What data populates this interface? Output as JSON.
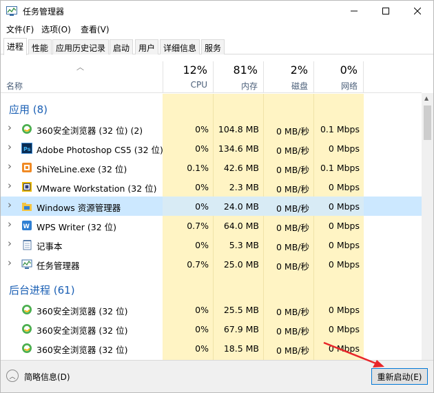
{
  "window": {
    "title": "任务管理器"
  },
  "menu": [
    "文件(F)",
    "选项(O)",
    "查看(V)"
  ],
  "tabs": [
    "进程",
    "性能",
    "应用历史记录",
    "启动",
    "用户",
    "详细信息",
    "服务"
  ],
  "columns": {
    "name": "名称",
    "cpu": {
      "pct": "12%",
      "label": "CPU"
    },
    "memory": {
      "pct": "81%",
      "label": "内存"
    },
    "disk": {
      "pct": "2%",
      "label": "磁盘"
    },
    "network": {
      "pct": "0%",
      "label": "网络"
    }
  },
  "groups": {
    "apps": "应用 (8)",
    "background": "后台进程 (61)"
  },
  "apps": [
    {
      "name": "360安全浏览器 (32 位) (2)",
      "cpu": "0%",
      "mem": "104.8 MB",
      "disk": "0 MB/秒",
      "net": "0.1 Mbps",
      "icon": "360-browser-icon"
    },
    {
      "name": "Adobe Photoshop CS5 (32 位)",
      "cpu": "0%",
      "mem": "134.6 MB",
      "disk": "0 MB/秒",
      "net": "0 Mbps",
      "icon": "photoshop-icon"
    },
    {
      "name": "ShiYeLine.exe (32 位)",
      "cpu": "0.1%",
      "mem": "42.6 MB",
      "disk": "0 MB/秒",
      "net": "0.1 Mbps",
      "icon": "shiyeline-icon"
    },
    {
      "name": "VMware Workstation (32 位)",
      "cpu": "0%",
      "mem": "2.3 MB",
      "disk": "0 MB/秒",
      "net": "0 Mbps",
      "icon": "vmware-icon"
    },
    {
      "name": "Windows 资源管理器",
      "cpu": "0%",
      "mem": "24.0 MB",
      "disk": "0 MB/秒",
      "net": "0 Mbps",
      "icon": "explorer-icon"
    },
    {
      "name": "WPS Writer (32 位)",
      "cpu": "0.7%",
      "mem": "64.0 MB",
      "disk": "0 MB/秒",
      "net": "0 Mbps",
      "icon": "wps-writer-icon"
    },
    {
      "name": "记事本",
      "cpu": "0%",
      "mem": "5.3 MB",
      "disk": "0 MB/秒",
      "net": "0 Mbps",
      "icon": "notepad-icon"
    },
    {
      "name": "任务管理器",
      "cpu": "0.7%",
      "mem": "25.0 MB",
      "disk": "0 MB/秒",
      "net": "0 Mbps",
      "icon": "task-manager-icon"
    }
  ],
  "background": [
    {
      "name": "360安全浏览器 (32 位)",
      "cpu": "0%",
      "mem": "25.5 MB",
      "disk": "0 MB/秒",
      "net": "0 Mbps",
      "icon": "360-browser-icon"
    },
    {
      "name": "360安全浏览器 (32 位)",
      "cpu": "0%",
      "mem": "67.9 MB",
      "disk": "0 MB/秒",
      "net": "0 Mbps",
      "icon": "360-browser-icon"
    },
    {
      "name": "360安全浏览器 (32 位)",
      "cpu": "0%",
      "mem": "18.5 MB",
      "disk": "0 MB/秒",
      "net": "0 Mbps",
      "icon": "360-browser-icon"
    }
  ],
  "footer": {
    "fewer_details": "简略信息(D)",
    "restart": "重新启动(E)"
  }
}
